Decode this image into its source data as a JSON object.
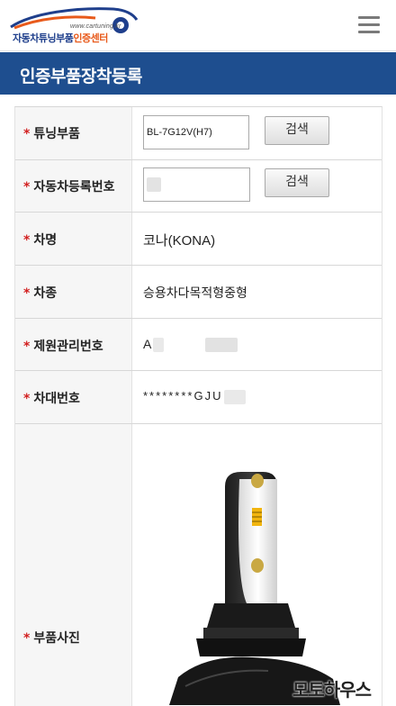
{
  "header": {
    "logo_url": "www.cartuning.kr",
    "logo_name_main": "자동차튜닝부품",
    "logo_name_accent": "인증센터",
    "menu_icon": "hamburger-menu-icon"
  },
  "page_title": "인증부품장착등록",
  "form": {
    "rows": [
      {
        "label": "튜닝부품",
        "value": "BL-7G12V(H7)",
        "button": "검색"
      },
      {
        "label": "자동차등록번호",
        "value": "",
        "button": "검색"
      },
      {
        "label": "차명",
        "value": "코나(KONA)"
      },
      {
        "label": "차종",
        "value": "승용차다목적형중형"
      },
      {
        "label": "제원관리번호",
        "value": "A"
      },
      {
        "label": "차대번호",
        "value": "********GJU"
      },
      {
        "label": "부품사진"
      }
    ],
    "required_mark": "*"
  },
  "watermark": "모토하우스",
  "colors": {
    "title_bar": "#1e4e8f",
    "required_star": "#d21f1f",
    "logo_blue": "#1f3f8c",
    "logo_orange": "#e85a1b"
  }
}
